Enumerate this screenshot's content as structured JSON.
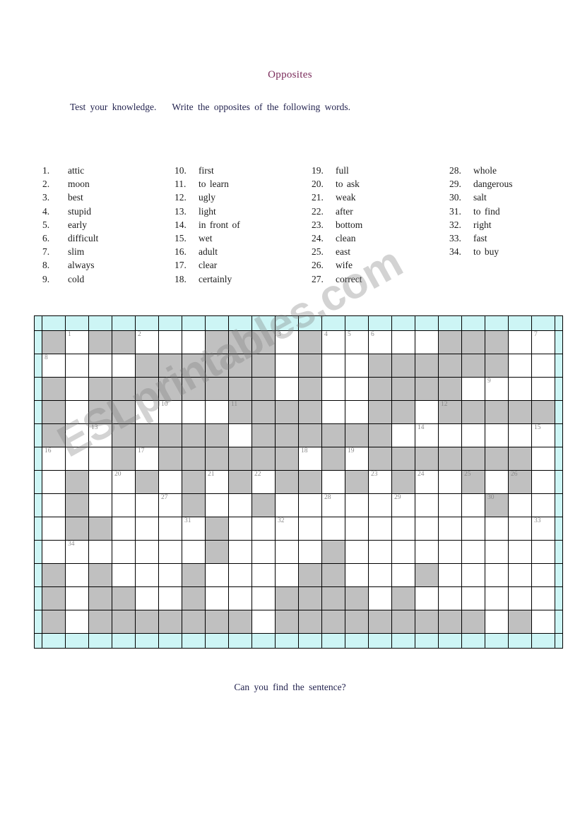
{
  "worksheet": {
    "title": "Opposites",
    "instruction_part1": "Test your knowledge.",
    "instruction_part2": "Write the opposites of the following words.",
    "footer_question": "Can you find the sentence?",
    "watermark": "ESLprintables.com"
  },
  "colors": {
    "title": "#7a2a5a",
    "text": "#23234f",
    "block_cell": "#c0c0c0",
    "edge_cell": "#cdf5f5",
    "white_cell": "#ffffff",
    "grid_line": "#000000",
    "clue_number": "#8a8a8a"
  },
  "word_columns": [
    {
      "items": [
        {
          "num": "1.",
          "word": "attic"
        },
        {
          "num": "2.",
          "word": "moon"
        },
        {
          "num": "3.",
          "word": "best"
        },
        {
          "num": "4.",
          "word": "stupid"
        },
        {
          "num": "5.",
          "word": "early"
        },
        {
          "num": "6.",
          "word": "difficult"
        },
        {
          "num": "7.",
          "word": "slim"
        },
        {
          "num": "8.",
          "word": "always"
        },
        {
          "num": "9.",
          "word": "cold"
        }
      ]
    },
    {
      "items": [
        {
          "num": "10.",
          "word": "first"
        },
        {
          "num": "11.",
          "word": "to  learn"
        },
        {
          "num": "12.",
          "word": "ugly"
        },
        {
          "num": "13.",
          "word": "light"
        },
        {
          "num": "14.",
          "word": "in front of"
        },
        {
          "num": "15.",
          "word": "wet"
        },
        {
          "num": "16.",
          "word": "adult"
        },
        {
          "num": "17.",
          "word": "clear"
        },
        {
          "num": "18.",
          "word": "certainly"
        }
      ]
    },
    {
      "items": [
        {
          "num": "19.",
          "word": "full"
        },
        {
          "num": "20.",
          "word": "to  ask"
        },
        {
          "num": "21.",
          "word": "weak"
        },
        {
          "num": "22.",
          "word": "after"
        },
        {
          "num": "23.",
          "word": "bottom"
        },
        {
          "num": "24.",
          "word": "clean"
        },
        {
          "num": "25.",
          "word": "east"
        },
        {
          "num": "26.",
          "word": "wife"
        },
        {
          "num": "27.",
          "word": "correct"
        }
      ]
    },
    {
      "items": [
        {
          "num": "28.",
          "word": "whole"
        },
        {
          "num": "29.",
          "word": "dangerous"
        },
        {
          "num": "30.",
          "word": "salt"
        },
        {
          "num": "31.",
          "word": "to  find"
        },
        {
          "num": "32.",
          "word": "right"
        },
        {
          "num": "33.",
          "word": "fast"
        },
        {
          "num": "34.",
          "word": "to  buy"
        }
      ]
    }
  ],
  "crossword": {
    "columns": 24,
    "rows": 14,
    "legend": {
      "e": "edge-cyan",
      "w": "white-fillable",
      "b": "blocked-gray"
    },
    "cells": [
      [
        "e",
        "e",
        "e",
        "e",
        "e",
        "e",
        "e",
        "e",
        "e",
        "e",
        "e",
        "e",
        "e",
        "e",
        "e",
        "e",
        "e",
        "e",
        "e",
        "e",
        "e",
        "e",
        "e",
        "e"
      ],
      [
        "e",
        "b",
        "w",
        "b",
        "b",
        "w",
        "w",
        "w",
        "b",
        "b",
        "b",
        "w",
        "b",
        "w",
        "w",
        "w",
        "w",
        "w",
        "b",
        "b",
        "b",
        "w",
        "w",
        "e"
      ],
      [
        "e",
        "w",
        "w",
        "w",
        "w",
        "b",
        "b",
        "b",
        "b",
        "b",
        "b",
        "w",
        "b",
        "w",
        "w",
        "b",
        "b",
        "b",
        "b",
        "b",
        "b",
        "w",
        "w",
        "e"
      ],
      [
        "e",
        "b",
        "w",
        "b",
        "b",
        "b",
        "b",
        "b",
        "b",
        "b",
        "b",
        "w",
        "b",
        "w",
        "w",
        "b",
        "b",
        "b",
        "b",
        "w",
        "w",
        "w",
        "w",
        "e"
      ],
      [
        "e",
        "b",
        "w",
        "b",
        "b",
        "w",
        "w",
        "w",
        "w",
        "b",
        "b",
        "b",
        "b",
        "w",
        "w",
        "b",
        "b",
        "w",
        "b",
        "b",
        "b",
        "b",
        "b",
        "e"
      ],
      [
        "e",
        "b",
        "w",
        "w",
        "b",
        "b",
        "b",
        "b",
        "b",
        "w",
        "b",
        "b",
        "b",
        "b",
        "b",
        "b",
        "w",
        "w",
        "w",
        "w",
        "w",
        "w",
        "w",
        "e"
      ],
      [
        "e",
        "w",
        "w",
        "w",
        "b",
        "w",
        "b",
        "b",
        "b",
        "b",
        "b",
        "b",
        "w",
        "b",
        "w",
        "b",
        "b",
        "b",
        "b",
        "b",
        "b",
        "b",
        "w",
        "e"
      ],
      [
        "e",
        "w",
        "b",
        "w",
        "w",
        "b",
        "w",
        "b",
        "w",
        "b",
        "w",
        "b",
        "b",
        "w",
        "b",
        "w",
        "b",
        "w",
        "w",
        "b",
        "w",
        "b",
        "w",
        "e"
      ],
      [
        "e",
        "w",
        "b",
        "w",
        "w",
        "w",
        "w",
        "b",
        "w",
        "w",
        "b",
        "w",
        "w",
        "w",
        "w",
        "w",
        "w",
        "w",
        "w",
        "w",
        "b",
        "w",
        "w",
        "e"
      ],
      [
        "e",
        "w",
        "b",
        "b",
        "w",
        "w",
        "w",
        "w",
        "b",
        "w",
        "w",
        "w",
        "w",
        "w",
        "w",
        "w",
        "w",
        "w",
        "w",
        "w",
        "w",
        "w",
        "w",
        "e"
      ],
      [
        "e",
        "w",
        "w",
        "w",
        "w",
        "w",
        "w",
        "w",
        "b",
        "w",
        "w",
        "w",
        "w",
        "b",
        "w",
        "w",
        "w",
        "w",
        "w",
        "w",
        "w",
        "w",
        "w",
        "e"
      ],
      [
        "e",
        "b",
        "w",
        "b",
        "w",
        "w",
        "w",
        "b",
        "w",
        "w",
        "w",
        "w",
        "b",
        "b",
        "w",
        "w",
        "w",
        "b",
        "w",
        "w",
        "w",
        "w",
        "w",
        "e"
      ],
      [
        "e",
        "b",
        "w",
        "b",
        "b",
        "w",
        "w",
        "b",
        "w",
        "w",
        "w",
        "b",
        "b",
        "b",
        "b",
        "w",
        "b",
        "w",
        "w",
        "w",
        "w",
        "w",
        "w",
        "e"
      ],
      [
        "e",
        "b",
        "w",
        "b",
        "b",
        "b",
        "b",
        "b",
        "b",
        "b",
        "w",
        "b",
        "b",
        "b",
        "b",
        "b",
        "b",
        "b",
        "b",
        "b",
        "w",
        "b",
        "w",
        "e"
      ],
      [
        "e",
        "e",
        "e",
        "e",
        "e",
        "e",
        "e",
        "e",
        "e",
        "e",
        "e",
        "e",
        "e",
        "e",
        "e",
        "e",
        "e",
        "e",
        "e",
        "e",
        "e",
        "e",
        "e",
        "e"
      ]
    ],
    "numbers": [
      {
        "row": 1,
        "col": 2,
        "label": "1"
      },
      {
        "row": 1,
        "col": 5,
        "label": "2"
      },
      {
        "row": 1,
        "col": 11,
        "label": "3"
      },
      {
        "row": 1,
        "col": 13,
        "label": "4"
      },
      {
        "row": 1,
        "col": 14,
        "label": "5"
      },
      {
        "row": 1,
        "col": 15,
        "label": "6"
      },
      {
        "row": 1,
        "col": 22,
        "label": "7"
      },
      {
        "row": 2,
        "col": 1,
        "label": "8"
      },
      {
        "row": 3,
        "col": 20,
        "label": "9"
      },
      {
        "row": 4,
        "col": 6,
        "label": "10"
      },
      {
        "row": 4,
        "col": 9,
        "label": "11"
      },
      {
        "row": 4,
        "col": 18,
        "label": "12"
      },
      {
        "row": 5,
        "col": 3,
        "label": "13"
      },
      {
        "row": 5,
        "col": 17,
        "label": "14"
      },
      {
        "row": 5,
        "col": 22,
        "label": "15"
      },
      {
        "row": 6,
        "col": 1,
        "label": "16"
      },
      {
        "row": 6,
        "col": 5,
        "label": "17"
      },
      {
        "row": 6,
        "col": 12,
        "label": "18"
      },
      {
        "row": 6,
        "col": 14,
        "label": "19"
      },
      {
        "row": 7,
        "col": 4,
        "label": "20"
      },
      {
        "row": 7,
        "col": 8,
        "label": "21"
      },
      {
        "row": 7,
        "col": 10,
        "label": "22"
      },
      {
        "row": 7,
        "col": 15,
        "label": "23"
      },
      {
        "row": 7,
        "col": 17,
        "label": "24"
      },
      {
        "row": 7,
        "col": 19,
        "label": "25"
      },
      {
        "row": 7,
        "col": 21,
        "label": "26"
      },
      {
        "row": 8,
        "col": 6,
        "label": "27"
      },
      {
        "row": 8,
        "col": 13,
        "label": "28"
      },
      {
        "row": 8,
        "col": 16,
        "label": "29"
      },
      {
        "row": 8,
        "col": 20,
        "label": "30"
      },
      {
        "row": 9,
        "col": 7,
        "label": "31"
      },
      {
        "row": 9,
        "col": 11,
        "label": "32"
      },
      {
        "row": 9,
        "col": 22,
        "label": "33"
      },
      {
        "row": 10,
        "col": 2,
        "label": "34"
      }
    ]
  }
}
